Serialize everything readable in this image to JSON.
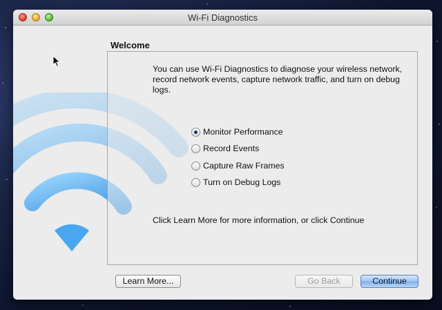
{
  "window": {
    "title": "Wi-Fi Diagnostics"
  },
  "page": {
    "heading": "Welcome",
    "intro": "You can use Wi-Fi Diagnostics to diagnose your wireless network, record network events, capture network traffic, and turn on debug logs.",
    "options": [
      {
        "label": "Monitor Performance",
        "checked": true
      },
      {
        "label": "Record Events",
        "checked": false
      },
      {
        "label": "Capture Raw Frames",
        "checked": false
      },
      {
        "label": "Turn on Debug Logs",
        "checked": false
      }
    ],
    "footer": "Click Learn More for more information, or click Continue"
  },
  "buttons": {
    "learn_more": "Learn More...",
    "go_back": "Go Back",
    "continue": "Continue"
  },
  "icons": {
    "wifi": "wifi-icon",
    "cursor": "mouse-pointer-icon"
  },
  "colors": {
    "wifi_blue": "#4aa8ea",
    "default_button": "#8fbcef"
  }
}
